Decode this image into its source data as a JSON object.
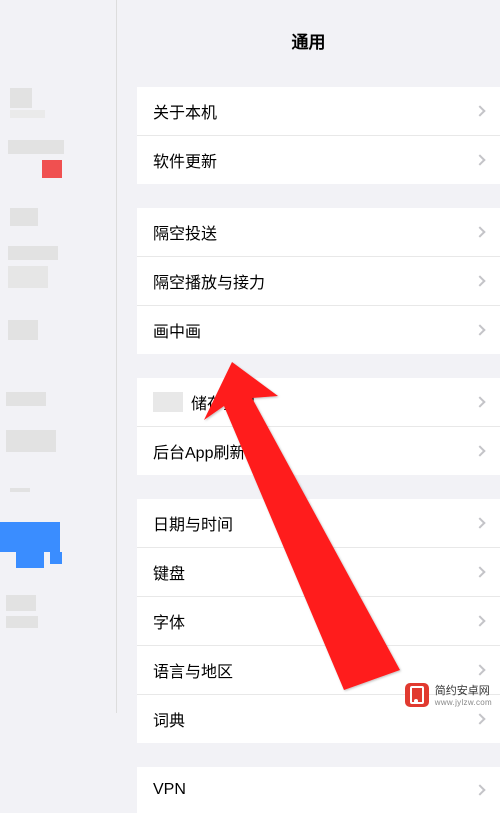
{
  "page_title": "通用",
  "groups": [
    {
      "rows": [
        {
          "name": "about",
          "label": "关于本机"
        },
        {
          "name": "software-update",
          "label": "软件更新"
        }
      ]
    },
    {
      "rows": [
        {
          "name": "airdrop",
          "label": "隔空投送"
        },
        {
          "name": "airplay-handoff",
          "label": "隔空播放与接力"
        },
        {
          "name": "picture-in-picture",
          "label": "画中画"
        }
      ]
    },
    {
      "rows": [
        {
          "name": "storage",
          "label": "储存空间",
          "blurred_prefix": true
        },
        {
          "name": "background-app-refresh",
          "label": "后台App刷新"
        }
      ]
    },
    {
      "rows": [
        {
          "name": "date-time",
          "label": "日期与时间"
        },
        {
          "name": "keyboard",
          "label": "键盘"
        },
        {
          "name": "fonts",
          "label": "字体"
        },
        {
          "name": "language-region",
          "label": "语言与地区"
        },
        {
          "name": "dictionary",
          "label": "词典"
        }
      ]
    },
    {
      "rows": [
        {
          "name": "vpn",
          "label": "VPN"
        }
      ]
    }
  ],
  "watermark": {
    "cn": "简约安卓网",
    "en": "www.jylzw.com"
  }
}
